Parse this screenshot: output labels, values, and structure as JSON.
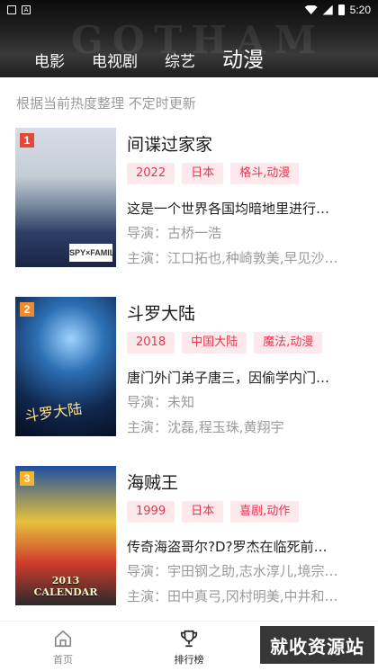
{
  "status_bar": {
    "time": "5:20"
  },
  "header": {
    "bg_text": "GOTHAM",
    "tabs": [
      {
        "label": "电影",
        "active": false
      },
      {
        "label": "电视剧",
        "active": false
      },
      {
        "label": "综艺",
        "active": false
      },
      {
        "label": "动漫",
        "active": true
      }
    ]
  },
  "subtitle": "根据当前热度整理 不定时更新",
  "items": [
    {
      "rank": "1",
      "title": "间谍过家家",
      "tags": [
        "2022",
        "日本",
        "格斗,动漫"
      ],
      "desc": "这是一个世界各国均暗地里进行…",
      "director": "导演：古桥一浩",
      "actors": "主演：江口拓也,种崎敦美,早见沙…",
      "poster_text": "SPY×FAMILY",
      "badge_color": "#e5483b"
    },
    {
      "rank": "2",
      "title": "斗罗大陆",
      "tags": [
        "2018",
        "中国大陆",
        "魔法,动漫"
      ],
      "desc": "唐门外门弟子唐三，因偷学内门…",
      "director": "导演：未知",
      "actors": "主演：沈磊,程玉珠,黄翔宇",
      "poster_text": "斗罗大陆",
      "badge_color": "#f08a2c"
    },
    {
      "rank": "3",
      "title": "海贼王",
      "tags": [
        "1999",
        "日本",
        "喜剧,动作"
      ],
      "desc": "传奇海盗哥尔?D?罗杰在临死前…",
      "director": "导演：宇田钢之助,志水淳儿,境宗…",
      "actors": "主演：田中真弓,冈村明美,中井和…",
      "poster_text": "2013 CALENDAR",
      "badge_color": "#f3b62b"
    }
  ],
  "bottom_nav": [
    {
      "label": "首页",
      "icon": "home-icon",
      "active": false
    },
    {
      "label": "排行榜",
      "icon": "trophy-icon",
      "active": true
    },
    {
      "label": "",
      "icon": "",
      "active": false
    }
  ],
  "watermark": "就收资源站"
}
